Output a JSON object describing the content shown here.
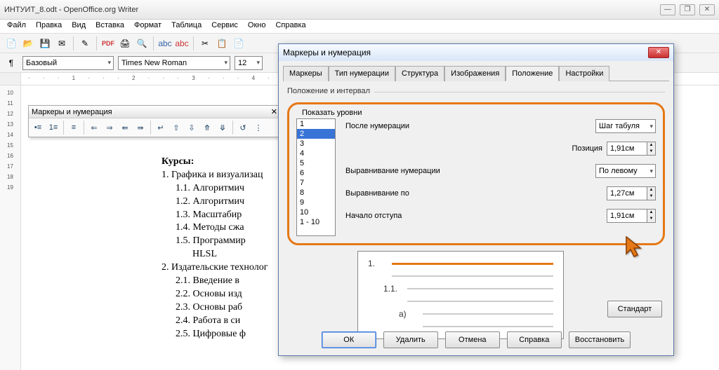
{
  "window": {
    "title": "ИНТУИТ_8.odt - OpenOffice.org Writer"
  },
  "menu": [
    "Файл",
    "Правка",
    "Вид",
    "Вставка",
    "Формат",
    "Таблица",
    "Сервис",
    "Окно",
    "Справка"
  ],
  "style_combo": "Базовый",
  "font_combo": "Times New Roman",
  "size_combo": "12",
  "floating_toolbar_title": "Маркеры и нумерация",
  "hruler": "· · · 1 · · · 2 · · · 3 · · · 4 · · · 5 · · · 6 · · · 7 · · · 8 · · · 9",
  "vruler": [
    "10",
    "11",
    "12",
    "13",
    "14",
    "15",
    "16",
    "17",
    "18",
    "19"
  ],
  "doc": {
    "title": "Курсы:",
    "item1": "1.  Графика и визуализац",
    "sub": [
      "1.1.        Алгоритмич",
      "1.2.        Алгоритмич",
      "1.3.        Масштабир",
      "1.4.        Методы сжа",
      "1.5.        Программир"
    ],
    "hlsl": "HLSL",
    "item2": "2.  Издательские технолог",
    "sub2": [
      "2.1.        Введение в",
      "2.2.        Основы изд",
      "2.3.        Основы раб",
      "2.4.        Работа в си",
      "2.5.        Цифровые ф"
    ]
  },
  "dialog": {
    "title": "Маркеры и нумерация",
    "tabs": [
      "Маркеры",
      "Тип нумерации",
      "Структура",
      "Изображения",
      "Положение",
      "Настройки"
    ],
    "active_tab": 4,
    "group_label": "Положение и интервал",
    "levels_label": "Показать уровни",
    "levels": [
      "1",
      "2",
      "3",
      "4",
      "5",
      "6",
      "7",
      "8",
      "9",
      "10",
      "1 - 10"
    ],
    "selected_level": 1,
    "field_after_num": "После нумерации",
    "val_after_num": "Шаг табуля",
    "field_pos": "Позиция",
    "val_pos": "1,91см",
    "field_align_num": "Выравнивание нумерации",
    "val_align_num": "По левому",
    "field_align_at": "Выравнивание по",
    "val_align_at": "1,27см",
    "field_indent": "Начало отступа",
    "val_indent": "1,91см",
    "preview": {
      "l1": "1.",
      "l2": "1.1.",
      "l3": "a)"
    },
    "btn_standard": "Стандарт",
    "buttons": [
      "ОК",
      "Удалить",
      "Отмена",
      "Справка",
      "Восстановить"
    ]
  }
}
